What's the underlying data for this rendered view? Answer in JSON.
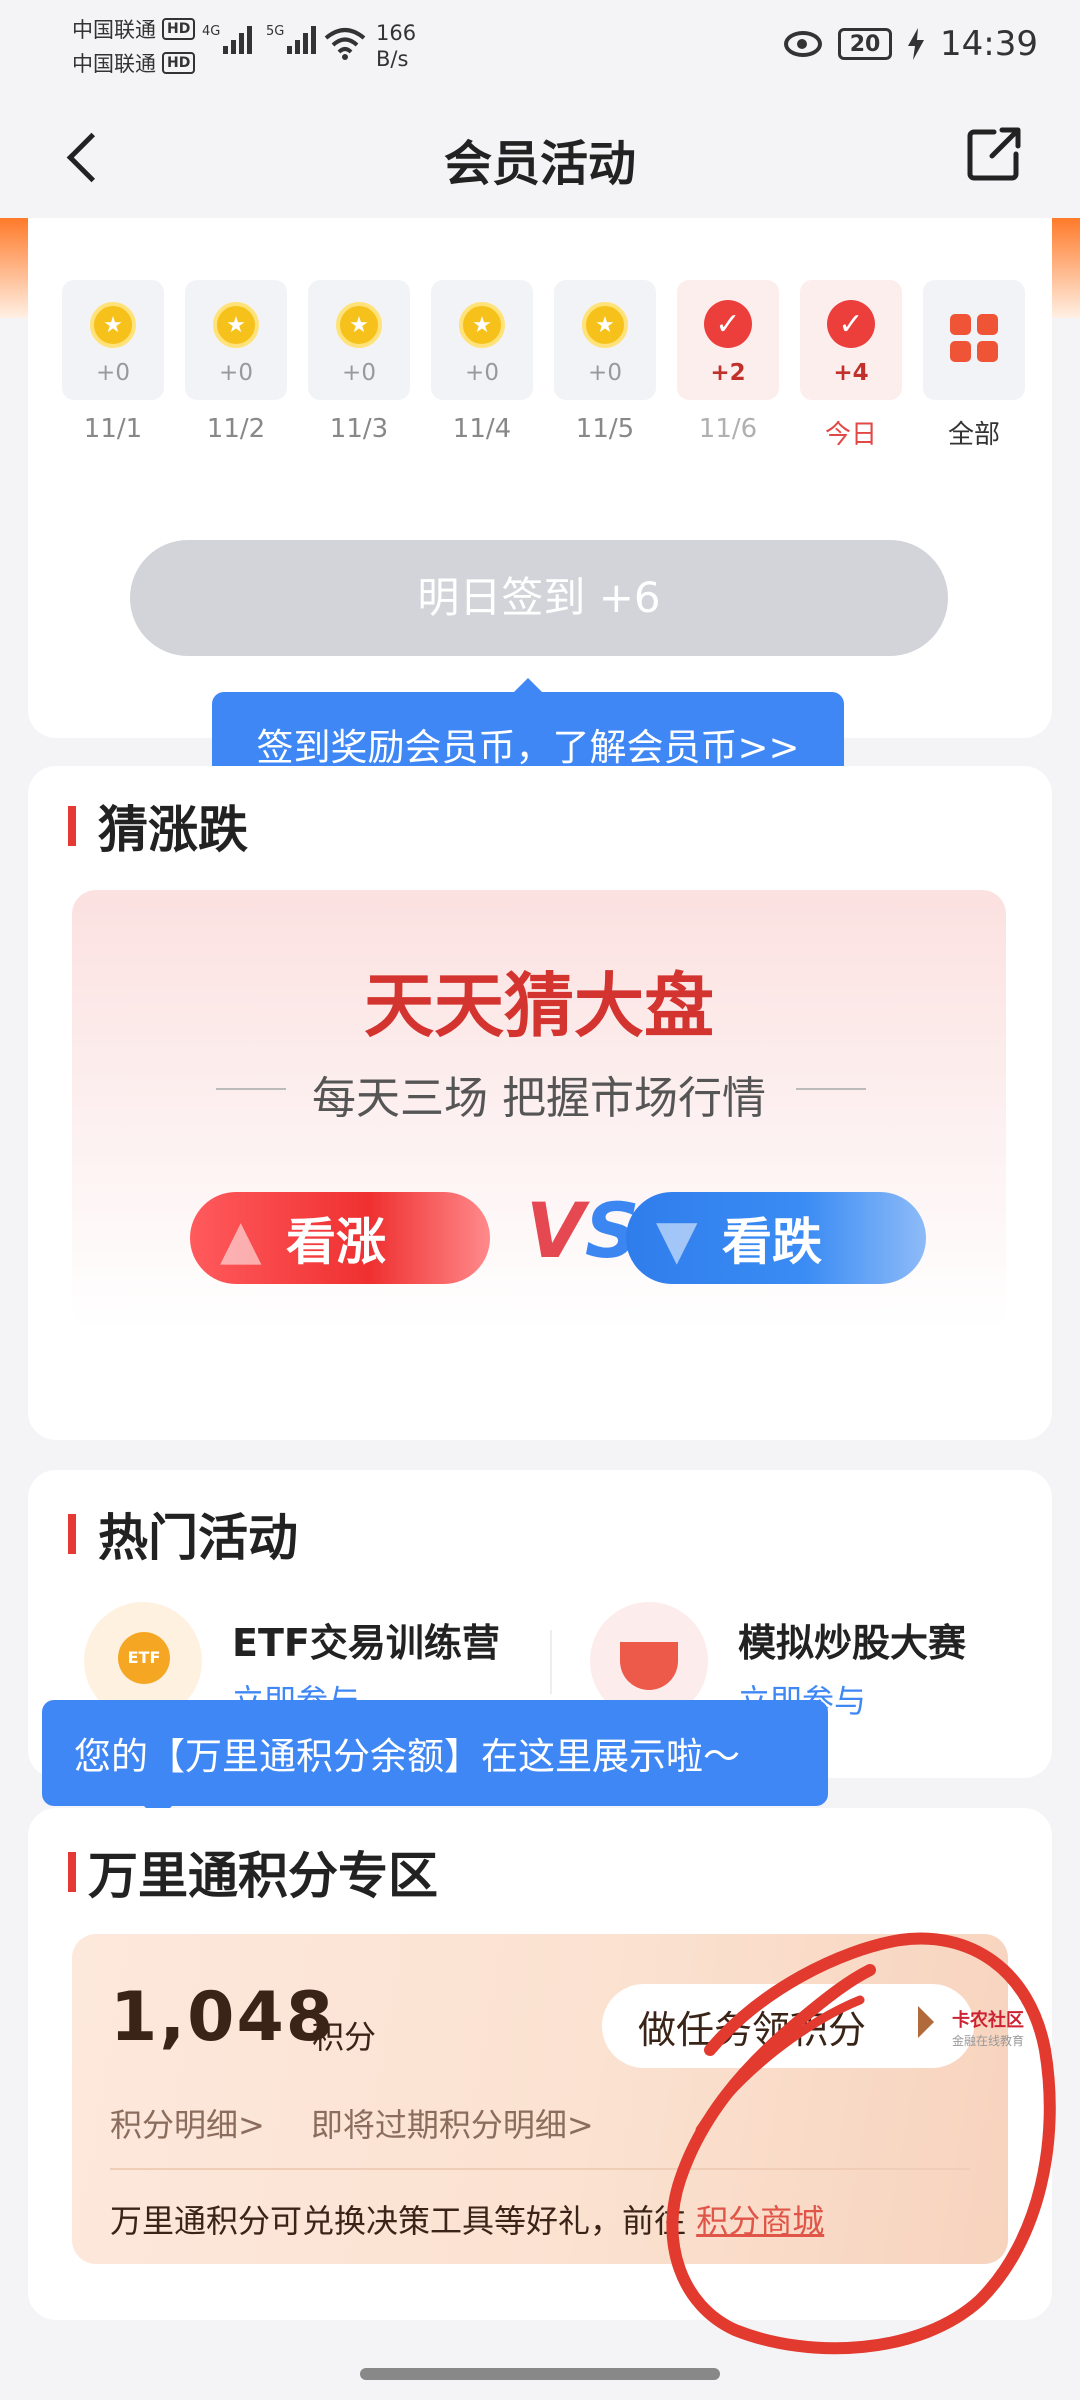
{
  "status_bar": {
    "carrier1": "中国联通",
    "carrier2": "中国联通",
    "hd": "HD",
    "net1": "4G",
    "net2": "5G",
    "speed_value": "166",
    "speed_unit": "B/s",
    "battery": "20",
    "time": "14:39"
  },
  "nav": {
    "title": "会员活动",
    "back_icon": "chevron-left-icon",
    "share_icon": "share-icon"
  },
  "checkin": {
    "days": [
      {
        "date": "11/1",
        "points": "+0",
        "state": "coin"
      },
      {
        "date": "11/2",
        "points": "+0",
        "state": "coin"
      },
      {
        "date": "11/3",
        "points": "+0",
        "state": "coin"
      },
      {
        "date": "11/4",
        "points": "+0",
        "state": "coin"
      },
      {
        "date": "11/5",
        "points": "+0",
        "state": "coin"
      },
      {
        "date": "11/6",
        "points": "+2",
        "state": "checked"
      },
      {
        "date": "今日",
        "points": "+4",
        "state": "checked"
      }
    ],
    "all_label": "全部",
    "button_label": "明日签到 +6",
    "tooltip": "签到奖励会员币，了解会员币>>"
  },
  "guess": {
    "section_title": "猜涨跌",
    "banner_title": "天天猜大盘",
    "banner_subtitle": "每天三场 把握市场行情",
    "up_label": "看涨",
    "down_label": "看跌",
    "vs_v": "V",
    "vs_s": "S"
  },
  "hot": {
    "section_title": "热门活动",
    "items": [
      {
        "name": "ETF交易训练营",
        "link": "立即参与",
        "icon_text": "ETF"
      },
      {
        "name": "模拟炒股大赛",
        "link": "立即参与"
      }
    ],
    "tooltip": "您的【万里通积分余额】在这里展示啦～"
  },
  "points": {
    "section_title": "万里通积分专区",
    "value": "1,048",
    "unit": "积分",
    "task_button": "做任务领积分",
    "detail_link": "积分明细>",
    "expiring_link": "即将过期积分明细>",
    "footer_text": "万里通积分可兑换决策工具等好礼，前往 ",
    "mall_link": "积分商城"
  },
  "watermark": {
    "name": "卡农社区",
    "sub": "金融在线教育"
  },
  "colors": {
    "accent_red": "#e53935",
    "tip_blue": "#3f87f5",
    "annotation_red": "#e23a2e"
  }
}
